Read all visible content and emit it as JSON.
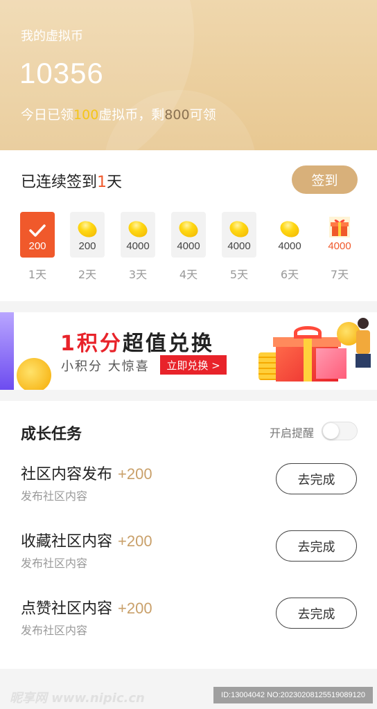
{
  "header": {
    "title": "我的虚拟币",
    "balance": "10356",
    "note_prefix": "今日已领",
    "note_claimed": "100",
    "note_middle": "虚拟币，剩",
    "note_remaining": "800",
    "note_suffix": "可领"
  },
  "signin": {
    "title_prefix": "已连续签到",
    "title_days": "1",
    "title_suffix": "天",
    "button_label": "签到",
    "days": [
      {
        "value": "200",
        "label": "1天",
        "state": "checked"
      },
      {
        "value": "200",
        "label": "2天",
        "state": "pending"
      },
      {
        "value": "4000",
        "label": "3天",
        "state": "pending"
      },
      {
        "value": "4000",
        "label": "4天",
        "state": "pending"
      },
      {
        "value": "4000",
        "label": "5天",
        "state": "pending"
      },
      {
        "value": "4000",
        "label": "6天",
        "state": "pending"
      },
      {
        "value": "4000",
        "label": "7天",
        "state": "gift"
      }
    ]
  },
  "banner": {
    "headline_num": "1",
    "headline_rest_red": "积分",
    "headline_rest": "超值兑换",
    "subtitle": "小积分 大惊喜",
    "button_label": "立即兑换 >"
  },
  "tasks": {
    "title": "成长任务",
    "remind_label": "开启提醒",
    "remind_on": false,
    "items": [
      {
        "name": "社区内容发布",
        "points": "+200",
        "desc": "发布社区内容",
        "button": "去完成"
      },
      {
        "name": "收藏社区内容",
        "points": "+200",
        "desc": "发布社区内容",
        "button": "去完成"
      },
      {
        "name": "点赞社区内容",
        "points": "+200",
        "desc": "发布社区内容",
        "button": "去完成"
      }
    ]
  },
  "watermark": {
    "left": "昵享网 www.nipic.cn",
    "right": "ID:13004042 NO:20230208125519089120"
  },
  "colors": {
    "accent": "#f0592b",
    "gold": "#d8b07a",
    "header_bg": "#ecd09f"
  }
}
